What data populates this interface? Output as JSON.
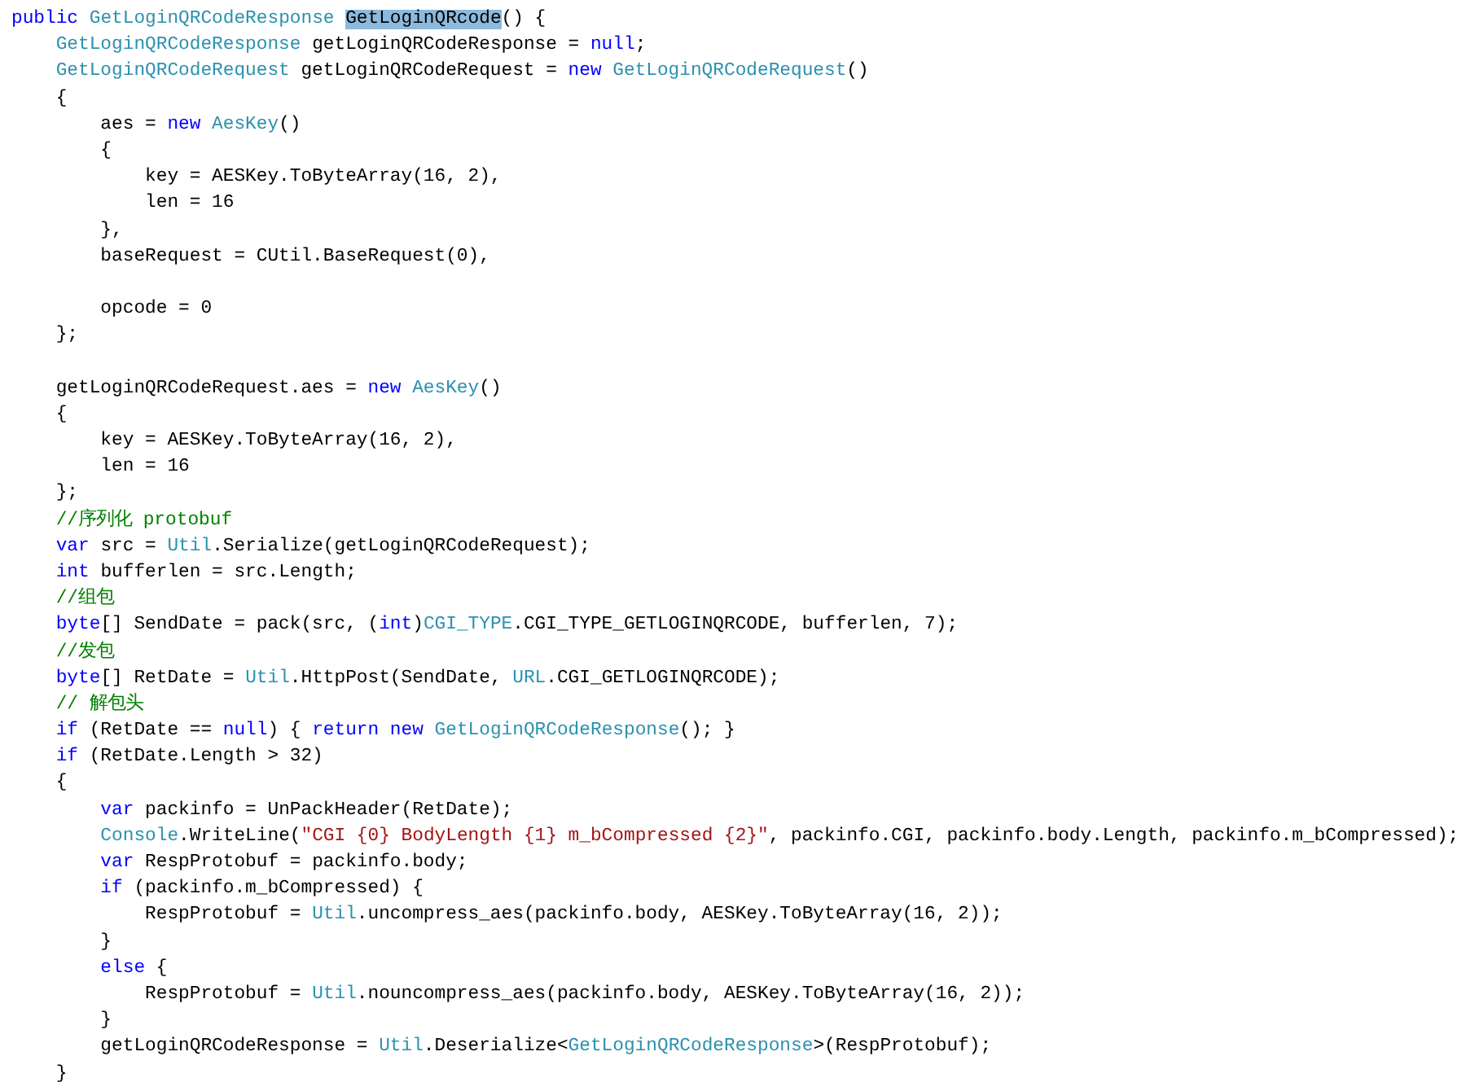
{
  "editor": {
    "lines": [
      {
        "tokens": [
          {
            "text": "public ",
            "kind": "keyword"
          },
          {
            "text": "GetLoginQRCodeResponse ",
            "kind": "type"
          },
          {
            "text": "GetLoginQRcode",
            "kind": "highlight"
          },
          {
            "text": "() {",
            "kind": "plain"
          }
        ]
      },
      {
        "tokens": [
          {
            "text": "    GetLoginQRCodeResponse",
            "kind": "type"
          },
          {
            "text": " getLoginQRCodeResponse = ",
            "kind": "plain"
          },
          {
            "text": "null",
            "kind": "keyword"
          },
          {
            "text": ";",
            "kind": "plain"
          }
        ]
      },
      {
        "tokens": [
          {
            "text": "    GetLoginQRCodeRequest",
            "kind": "type"
          },
          {
            "text": " getLoginQRCodeRequest = ",
            "kind": "plain"
          },
          {
            "text": "new ",
            "kind": "keyword"
          },
          {
            "text": "GetLoginQRCodeRequest",
            "kind": "type"
          },
          {
            "text": "()",
            "kind": "plain"
          }
        ]
      },
      {
        "tokens": [
          {
            "text": "    {",
            "kind": "plain"
          }
        ]
      },
      {
        "tokens": [
          {
            "text": "        aes = ",
            "kind": "plain"
          },
          {
            "text": "new ",
            "kind": "keyword"
          },
          {
            "text": "AesKey",
            "kind": "type"
          },
          {
            "text": "()",
            "kind": "plain"
          }
        ]
      },
      {
        "tokens": [
          {
            "text": "        {",
            "kind": "plain"
          }
        ]
      },
      {
        "tokens": [
          {
            "text": "            key = AESKey.ToByteArray(16, 2),",
            "kind": "plain"
          }
        ]
      },
      {
        "tokens": [
          {
            "text": "            len = 16",
            "kind": "plain"
          }
        ]
      },
      {
        "tokens": [
          {
            "text": "        },",
            "kind": "plain"
          }
        ]
      },
      {
        "tokens": [
          {
            "text": "        baseRequest = CUtil.BaseRequest(0),",
            "kind": "plain"
          }
        ]
      },
      {
        "blank_before": true,
        "tokens": [
          {
            "text": "        opcode = 0",
            "kind": "plain"
          }
        ]
      },
      {
        "tokens": [
          {
            "text": "    };",
            "kind": "plain"
          }
        ]
      },
      {
        "blank_before": true,
        "tokens": [
          {
            "text": "    getLoginQRCodeRequest.aes = ",
            "kind": "plain"
          },
          {
            "text": "new ",
            "kind": "keyword"
          },
          {
            "text": "AesKey",
            "kind": "type"
          },
          {
            "text": "()",
            "kind": "plain"
          }
        ]
      },
      {
        "tokens": [
          {
            "text": "    {",
            "kind": "plain"
          }
        ]
      },
      {
        "tokens": [
          {
            "text": "        key = AESKey.ToByteArray(16, 2),",
            "kind": "plain"
          }
        ]
      },
      {
        "tokens": [
          {
            "text": "        len = 16",
            "kind": "plain"
          }
        ]
      },
      {
        "tokens": [
          {
            "text": "    };",
            "kind": "plain"
          }
        ]
      },
      {
        "tokens": [
          {
            "text": "    //序列化 protobuf",
            "kind": "comment"
          }
        ]
      },
      {
        "tokens": [
          {
            "text": "    var",
            "kind": "keyword"
          },
          {
            "text": " src = ",
            "kind": "plain"
          },
          {
            "text": "Util",
            "kind": "type"
          },
          {
            "text": ".Serialize(getLoginQRCodeRequest);",
            "kind": "plain"
          }
        ]
      },
      {
        "tokens": [
          {
            "text": "    int",
            "kind": "keyword"
          },
          {
            "text": " bufferlen = src.Length;",
            "kind": "plain"
          }
        ]
      },
      {
        "tokens": [
          {
            "text": "    //组包",
            "kind": "comment"
          }
        ]
      },
      {
        "tokens": [
          {
            "text": "    byte",
            "kind": "keyword"
          },
          {
            "text": "[] SendDate = pack(src, (",
            "kind": "plain"
          },
          {
            "text": "int",
            "kind": "keyword"
          },
          {
            "text": ")",
            "kind": "plain"
          },
          {
            "text": "CGI_TYPE",
            "kind": "type"
          },
          {
            "text": ".CGI_TYPE_GETLOGINQRCODE, bufferlen, 7);",
            "kind": "plain"
          }
        ]
      },
      {
        "tokens": [
          {
            "text": "    //发包",
            "kind": "comment"
          }
        ]
      },
      {
        "tokens": [
          {
            "text": "    byte",
            "kind": "keyword"
          },
          {
            "text": "[] RetDate = ",
            "kind": "plain"
          },
          {
            "text": "Util",
            "kind": "type"
          },
          {
            "text": ".HttpPost(SendDate, ",
            "kind": "plain"
          },
          {
            "text": "URL",
            "kind": "type"
          },
          {
            "text": ".CGI_GETLOGINQRCODE);",
            "kind": "plain"
          }
        ]
      },
      {
        "tokens": [
          {
            "text": "    // 解包头",
            "kind": "comment"
          }
        ]
      },
      {
        "tokens": [
          {
            "text": "    if",
            "kind": "keyword"
          },
          {
            "text": " (RetDate == ",
            "kind": "plain"
          },
          {
            "text": "null",
            "kind": "keyword"
          },
          {
            "text": ") { ",
            "kind": "plain"
          },
          {
            "text": "return new ",
            "kind": "keyword"
          },
          {
            "text": "GetLoginQRCodeResponse",
            "kind": "type"
          },
          {
            "text": "(); }",
            "kind": "plain"
          }
        ]
      },
      {
        "tokens": [
          {
            "text": "    if",
            "kind": "keyword"
          },
          {
            "text": " (RetDate.Length > 32)",
            "kind": "plain"
          }
        ]
      },
      {
        "tokens": [
          {
            "text": "    {",
            "kind": "plain"
          }
        ]
      },
      {
        "tokens": [
          {
            "text": "        var",
            "kind": "keyword"
          },
          {
            "text": " packinfo = UnPackHeader(RetDate);",
            "kind": "plain"
          }
        ]
      },
      {
        "tokens": [
          {
            "text": "        Console",
            "kind": "type"
          },
          {
            "text": ".WriteLine(",
            "kind": "plain"
          },
          {
            "text": "\"CGI {0} BodyLength {1} m_bCompressed {2}\"",
            "kind": "string"
          },
          {
            "text": ", packinfo.CGI, packinfo.body.Length, packinfo.m_bCompressed);",
            "kind": "plain"
          }
        ]
      },
      {
        "tokens": [
          {
            "text": "        var",
            "kind": "keyword"
          },
          {
            "text": " RespProtobuf = packinfo.body;",
            "kind": "plain"
          }
        ]
      },
      {
        "tokens": [
          {
            "text": "        if",
            "kind": "keyword"
          },
          {
            "text": " (packinfo.m_bCompressed) {",
            "kind": "plain"
          }
        ]
      },
      {
        "tokens": [
          {
            "text": "            RespProtobuf = ",
            "kind": "plain"
          },
          {
            "text": "Util",
            "kind": "type"
          },
          {
            "text": ".uncompress_aes(packinfo.body, AESKey.ToByteArray(16, 2));",
            "kind": "plain"
          }
        ]
      },
      {
        "tokens": [
          {
            "text": "        }",
            "kind": "plain"
          }
        ]
      },
      {
        "tokens": [
          {
            "text": "        else",
            "kind": "keyword"
          },
          {
            "text": " {",
            "kind": "plain"
          }
        ]
      },
      {
        "tokens": [
          {
            "text": "            RespProtobuf = ",
            "kind": "plain"
          },
          {
            "text": "Util",
            "kind": "type"
          },
          {
            "text": ".nouncompress_aes(packinfo.body, AESKey.ToByteArray(16, 2));",
            "kind": "plain"
          }
        ]
      },
      {
        "tokens": [
          {
            "text": "        }",
            "kind": "plain"
          }
        ]
      },
      {
        "tokens": [
          {
            "text": "        getLoginQRCodeResponse = ",
            "kind": "plain"
          },
          {
            "text": "Util",
            "kind": "type"
          },
          {
            "text": ".Deserialize<",
            "kind": "plain"
          },
          {
            "text": "GetLoginQRCodeResponse",
            "kind": "type"
          },
          {
            "text": ">(RespProtobuf);",
            "kind": "plain"
          }
        ]
      },
      {
        "tokens": [
          {
            "text": "    }",
            "kind": "plain"
          }
        ]
      }
    ]
  }
}
